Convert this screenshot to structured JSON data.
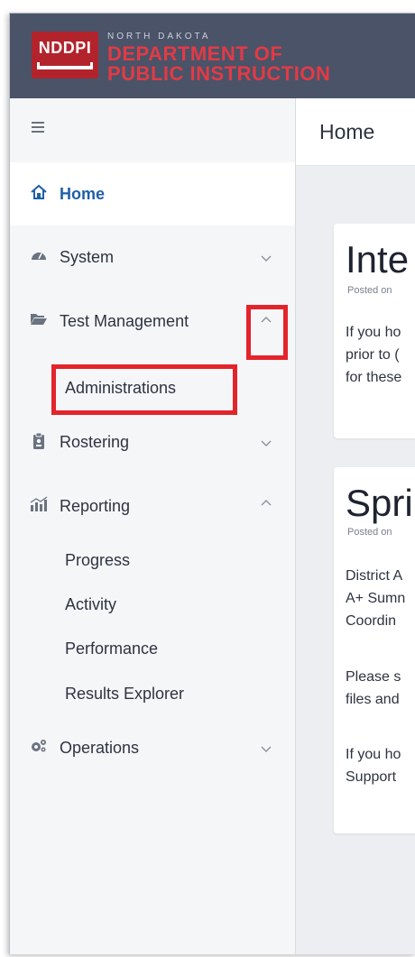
{
  "header": {
    "logo_abbr": "NDDPI",
    "logo_line1": "NORTH DAKOTA",
    "logo_line2": "DEPARTMENT OF",
    "logo_line3": "PUBLIC INSTRUCTION"
  },
  "topbar": {
    "title": "Home"
  },
  "sidebar": {
    "items": [
      {
        "label": "Home",
        "icon": "home-icon",
        "active": true
      },
      {
        "label": "System",
        "icon": "gauge-icon",
        "expanded": false
      },
      {
        "label": "Test Management",
        "icon": "folder-open-icon",
        "expanded": true,
        "children": [
          "Administrations"
        ]
      },
      {
        "label": "Rostering",
        "icon": "id-badge-icon",
        "expanded": false
      },
      {
        "label": "Reporting",
        "icon": "bar-chart-icon",
        "expanded": true,
        "children": [
          "Progress",
          "Activity",
          "Performance",
          "Results Explorer"
        ]
      },
      {
        "label": "Operations",
        "icon": "gears-icon",
        "expanded": false
      }
    ]
  },
  "cards": [
    {
      "title": "Inte",
      "posted": "Posted on",
      "lines": [
        "If you ho",
        "prior to (",
        "for these"
      ]
    },
    {
      "title": "Spri",
      "posted": "Posted on",
      "lines": [
        "District A",
        "A+ Sumn",
        "Coordin",
        "",
        "Please s",
        "files and",
        "",
        "If you ho",
        "Support"
      ]
    }
  ],
  "colors": {
    "header_bg": "#4a5368",
    "logo_red": "#b3232c",
    "active_blue": "#1f5fa8",
    "highlight_red": "#e3242b"
  }
}
